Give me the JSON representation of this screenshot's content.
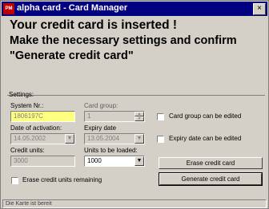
{
  "window": {
    "title": "alpha card - Card Manager",
    "close_glyph": "×",
    "icon_text": "PM"
  },
  "headline": {
    "line1": "Your credit card is inserted !",
    "line2": "Make the necessary settings and confirm",
    "line3": "\"Generate credit card\""
  },
  "settings": {
    "group_label": "Settings:",
    "system_nr": {
      "label": "System Nr.:",
      "value": "1806197C"
    },
    "card_group": {
      "label": "Card group:",
      "value": "1"
    },
    "date_of_activation": {
      "label": "Date of activation:",
      "value": "14.05.2002"
    },
    "expiry_date": {
      "label": "Expiry date",
      "value": "13.05.2004"
    },
    "credit_units": {
      "label": "Credit units:",
      "value": "3000"
    },
    "units_to_be_loaded": {
      "label": "Units to be loaded:",
      "value": "1000"
    },
    "chk_card_group": {
      "label": "Card group can be edited",
      "checked": false
    },
    "chk_expiry_date": {
      "label": "Expiry date can be edited",
      "checked": false
    },
    "chk_erase_remaining": {
      "label": "Erase credit units remaining",
      "checked": false
    },
    "erase_button": "Erase credit card",
    "generate_button": "Generate credit card"
  },
  "statusbar": {
    "text": "Die Karte ist bereit"
  },
  "icons": {
    "dropdown": "▼",
    "spin_up": "▲",
    "spin_down": "▼"
  }
}
